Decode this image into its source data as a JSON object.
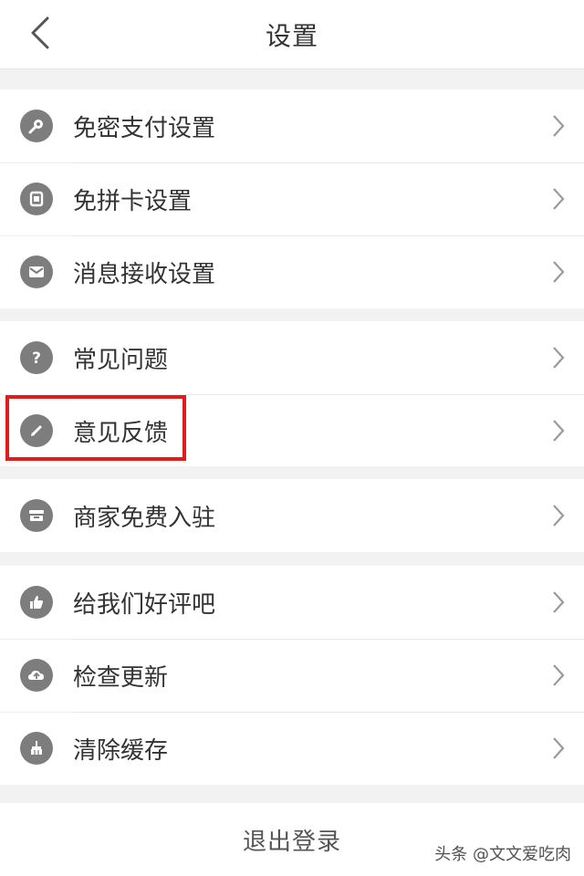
{
  "header": {
    "title": "设置",
    "back_icon": "chevron-left-icon"
  },
  "groups": [
    {
      "items": [
        {
          "label": "免密支付设置",
          "icon": "key-icon"
        },
        {
          "label": "免拼卡设置",
          "icon": "card-icon"
        },
        {
          "label": "消息接收设置",
          "icon": "mail-icon"
        }
      ]
    },
    {
      "items": [
        {
          "label": "常见问题",
          "icon": "question-icon"
        },
        {
          "label": "意见反馈",
          "icon": "edit-pencil-icon"
        }
      ]
    },
    {
      "items": [
        {
          "label": "商家免费入驻",
          "icon": "store-icon"
        }
      ]
    },
    {
      "items": [
        {
          "label": "给我们好评吧",
          "icon": "thumbs-up-icon"
        },
        {
          "label": "检查更新",
          "icon": "cloud-upload-icon"
        },
        {
          "label": "清除缓存",
          "icon": "broom-icon"
        }
      ]
    }
  ],
  "logout_label": "退出登录",
  "watermark": "头条 @文文爱吃肉",
  "colors": {
    "highlight": "#e01c1c",
    "icon_bg": "#7d7d7d",
    "text": "#333333"
  }
}
